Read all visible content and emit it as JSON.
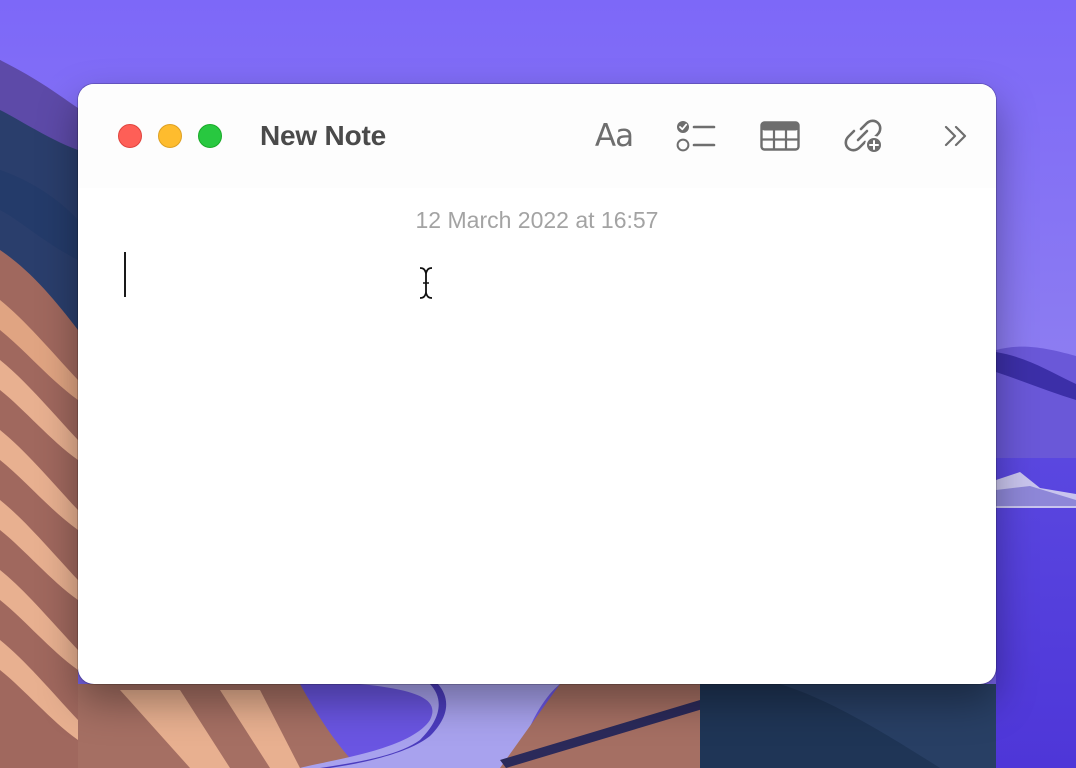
{
  "colors": {
    "desktop_background": "#7a66f2",
    "window_background": "#ffffff",
    "close_button": "#fe5f57",
    "minimize_button": "#febc2e",
    "zoom_button": "#28c840",
    "title_text": "#4a4a4a",
    "toolbar_icon": "#6e6e6e",
    "timestamp_text": "#a3a3a3"
  },
  "window": {
    "title": "New Note",
    "controls": {
      "close_icon": "close-icon",
      "minimize_icon": "minimize-icon",
      "zoom_icon": "zoom-icon"
    }
  },
  "toolbar": {
    "format_label": "Aa",
    "format_icon": "text-format-icon",
    "checklist_icon": "checklist-icon",
    "table_icon": "table-icon",
    "link_icon": "add-link-icon",
    "more_icon": "chevron-double-right-icon"
  },
  "note": {
    "timestamp": "12 March 2022 at 16:57",
    "body_text": ""
  }
}
